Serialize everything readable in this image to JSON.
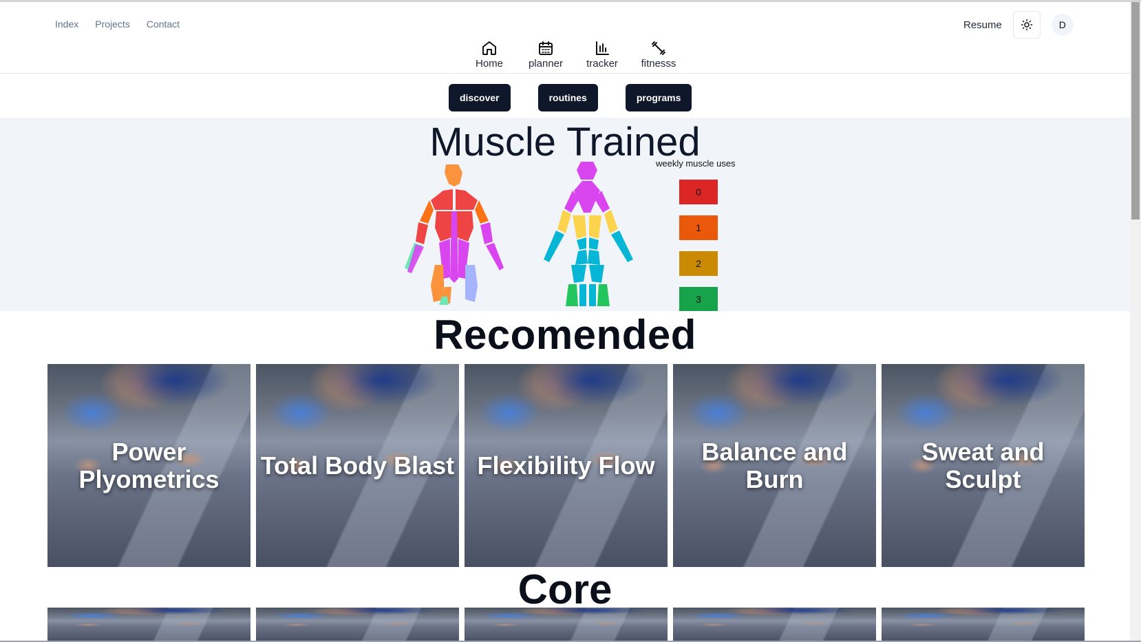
{
  "header": {
    "left_links": [
      "Index",
      "Projects",
      "Contact"
    ],
    "resume_label": "Resume",
    "avatar_initial": "D"
  },
  "center_nav": [
    {
      "label": "Home",
      "icon": "home-icon"
    },
    {
      "label": "planner",
      "icon": "calendar-icon"
    },
    {
      "label": "tracker",
      "icon": "bar-chart-icon"
    },
    {
      "label": "fitnesss",
      "icon": "dumbbell-icon"
    }
  ],
  "subtabs": [
    "discover",
    "routines",
    "programs"
  ],
  "muscle": {
    "title": "Muscle Trained",
    "legend_title": "weekly muscle uses",
    "legend": [
      {
        "label": "0",
        "color": "#dc2626"
      },
      {
        "label": "1",
        "color": "#ea580c"
      },
      {
        "label": "2",
        "color": "#ca8a04"
      },
      {
        "label": "3",
        "color": "#16a34a"
      }
    ]
  },
  "recommended": {
    "title": "Recomended",
    "cards": [
      "Power Plyometrics",
      "Total Body Blast",
      "Flexibility Flow",
      "Balance and Burn",
      "Sweat and Sculpt"
    ]
  },
  "core": {
    "title": "Core"
  },
  "colors": {
    "primary_button": "#0f172a",
    "section_bg": "#f1f5f9"
  }
}
